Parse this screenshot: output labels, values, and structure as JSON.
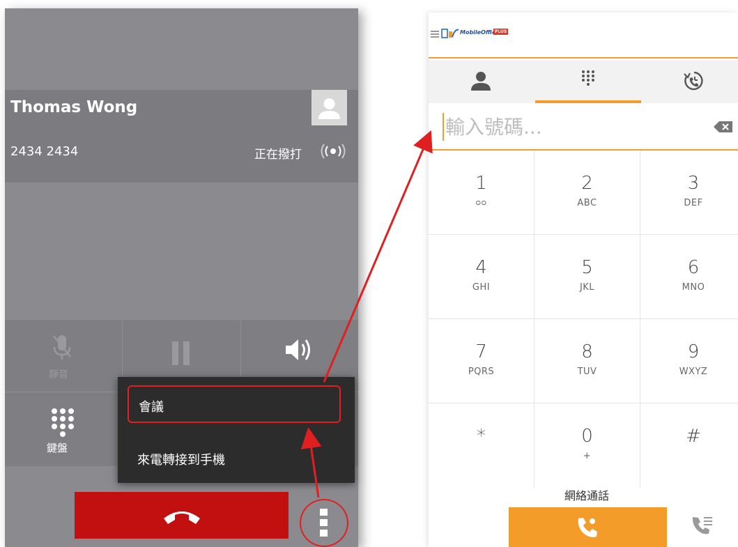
{
  "call_screen": {
    "caller_name": "Thomas Wong",
    "caller_number": "2434 2434",
    "status": "正在撥打",
    "controls": {
      "mute_label": "靜音",
      "keypad_label": "鍵盤"
    },
    "more_menu": {
      "items": [
        {
          "label": "會議"
        },
        {
          "label": "來電轉接到手機"
        }
      ]
    }
  },
  "dialer": {
    "logo_text": "MobileOffice",
    "logo_badge": "PLUS",
    "tabs": [
      "contacts-icon",
      "dialpad-icon",
      "history-icon"
    ],
    "input": {
      "placeholder": "輸入號碼...",
      "value": ""
    },
    "keys": [
      {
        "digit": "1",
        "letters": "ᴑᴑ"
      },
      {
        "digit": "2",
        "letters": "ABC"
      },
      {
        "digit": "3",
        "letters": "DEF"
      },
      {
        "digit": "4",
        "letters": "GHI"
      },
      {
        "digit": "5",
        "letters": "JKL"
      },
      {
        "digit": "6",
        "letters": "MNO"
      },
      {
        "digit": "7",
        "letters": "PQRS"
      },
      {
        "digit": "8",
        "letters": "TUV"
      },
      {
        "digit": "9",
        "letters": "WXYZ"
      },
      {
        "digit": "*",
        "letters": ""
      },
      {
        "digit": "0",
        "letters": "+"
      },
      {
        "digit": "#",
        "letters": ""
      }
    ],
    "net_call_label": "網絡通話"
  },
  "colors": {
    "accent_orange": "#f39c2a",
    "end_call_red": "#c20f0f",
    "highlight_red": "#e02020"
  }
}
